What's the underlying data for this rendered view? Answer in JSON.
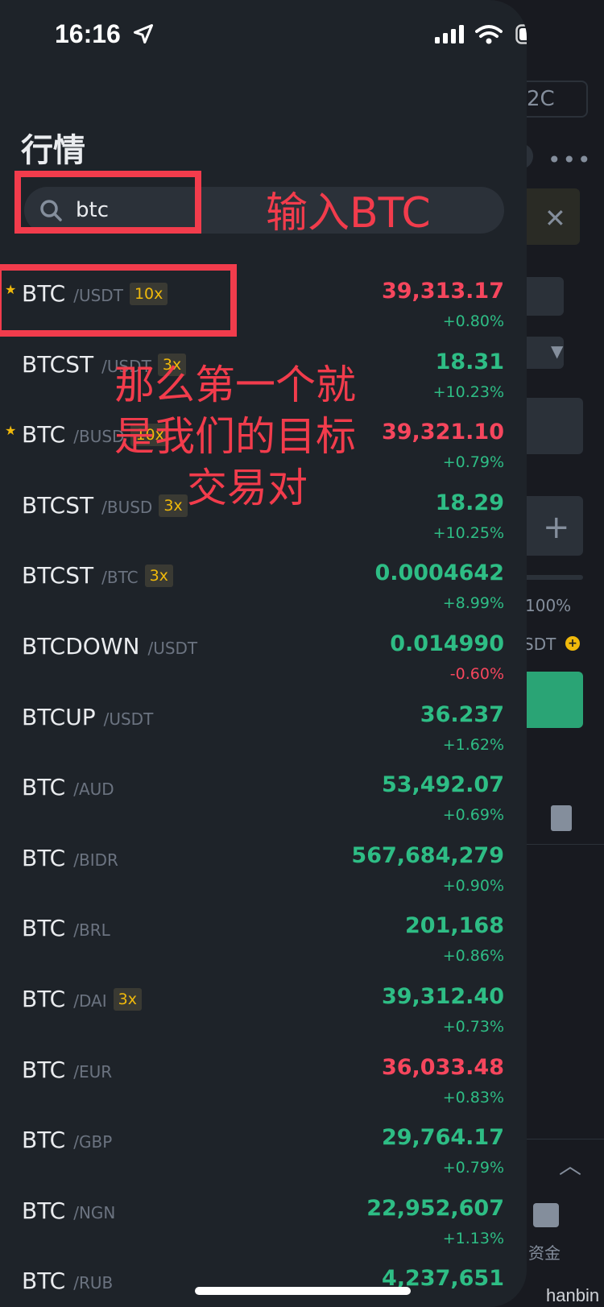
{
  "status_bar": {
    "time": "16:16"
  },
  "background": {
    "p2c_label": "2C",
    "percent_label": "100%",
    "usdt_label": "SDT",
    "funds_label": "资金"
  },
  "header": {
    "title": "行情"
  },
  "search": {
    "value": "btc"
  },
  "annotations": {
    "input_hint": "输入BTC",
    "target_note_line1": "那么第一个就",
    "target_note_line2": "是我们的目标",
    "target_note_line3": "交易对"
  },
  "pairs": [
    {
      "base": "BTC",
      "quote": "/USDT",
      "leverage": "10x",
      "price": "39,313.17",
      "change": "+0.80%",
      "price_dir": "down",
      "favorite": true
    },
    {
      "base": "BTCST",
      "quote": "/USDT",
      "leverage": "3x",
      "price": "18.31",
      "change": "+10.23%",
      "price_dir": "up",
      "favorite": false
    },
    {
      "base": "BTC",
      "quote": "/BUSD",
      "leverage": "10x",
      "price": "39,321.10",
      "change": "+0.79%",
      "price_dir": "down",
      "favorite": true
    },
    {
      "base": "BTCST",
      "quote": "/BUSD",
      "leverage": "3x",
      "price": "18.29",
      "change": "+10.25%",
      "price_dir": "up",
      "favorite": false
    },
    {
      "base": "BTCST",
      "quote": "/BTC",
      "leverage": "3x",
      "price": "0.0004642",
      "change": "+8.99%",
      "price_dir": "up",
      "favorite": false
    },
    {
      "base": "BTCDOWN",
      "quote": "/USDT",
      "leverage": "",
      "price": "0.014990",
      "change": "-0.60%",
      "price_dir": "up",
      "favorite": false
    },
    {
      "base": "BTCUP",
      "quote": "/USDT",
      "leverage": "",
      "price": "36.237",
      "change": "+1.62%",
      "price_dir": "up",
      "favorite": false
    },
    {
      "base": "BTC",
      "quote": "/AUD",
      "leverage": "",
      "price": "53,492.07",
      "change": "+0.69%",
      "price_dir": "up",
      "favorite": false
    },
    {
      "base": "BTC",
      "quote": "/BIDR",
      "leverage": "",
      "price": "567,684,279",
      "change": "+0.90%",
      "price_dir": "up",
      "favorite": false
    },
    {
      "base": "BTC",
      "quote": "/BRL",
      "leverage": "",
      "price": "201,168",
      "change": "+0.86%",
      "price_dir": "up",
      "favorite": false
    },
    {
      "base": "BTC",
      "quote": "/DAI",
      "leverage": "3x",
      "price": "39,312.40",
      "change": "+0.73%",
      "price_dir": "up",
      "favorite": false
    },
    {
      "base": "BTC",
      "quote": "/EUR",
      "leverage": "",
      "price": "36,033.48",
      "change": "+0.83%",
      "price_dir": "down",
      "favorite": false
    },
    {
      "base": "BTC",
      "quote": "/GBP",
      "leverage": "",
      "price": "29,764.17",
      "change": "+0.79%",
      "price_dir": "up",
      "favorite": false
    },
    {
      "base": "BTC",
      "quote": "/NGN",
      "leverage": "",
      "price": "22,952,607",
      "change": "+1.13%",
      "price_dir": "up",
      "favorite": false
    },
    {
      "base": "BTC",
      "quote": "/RUB",
      "leverage": "",
      "price": "4,237,651",
      "change": "",
      "price_dir": "up",
      "favorite": false
    }
  ],
  "watermark": "hanbin",
  "colors": {
    "up": "#2ebd85",
    "down": "#f6465d",
    "accent": "#f0b90b",
    "annotation": "#f23c4c"
  }
}
